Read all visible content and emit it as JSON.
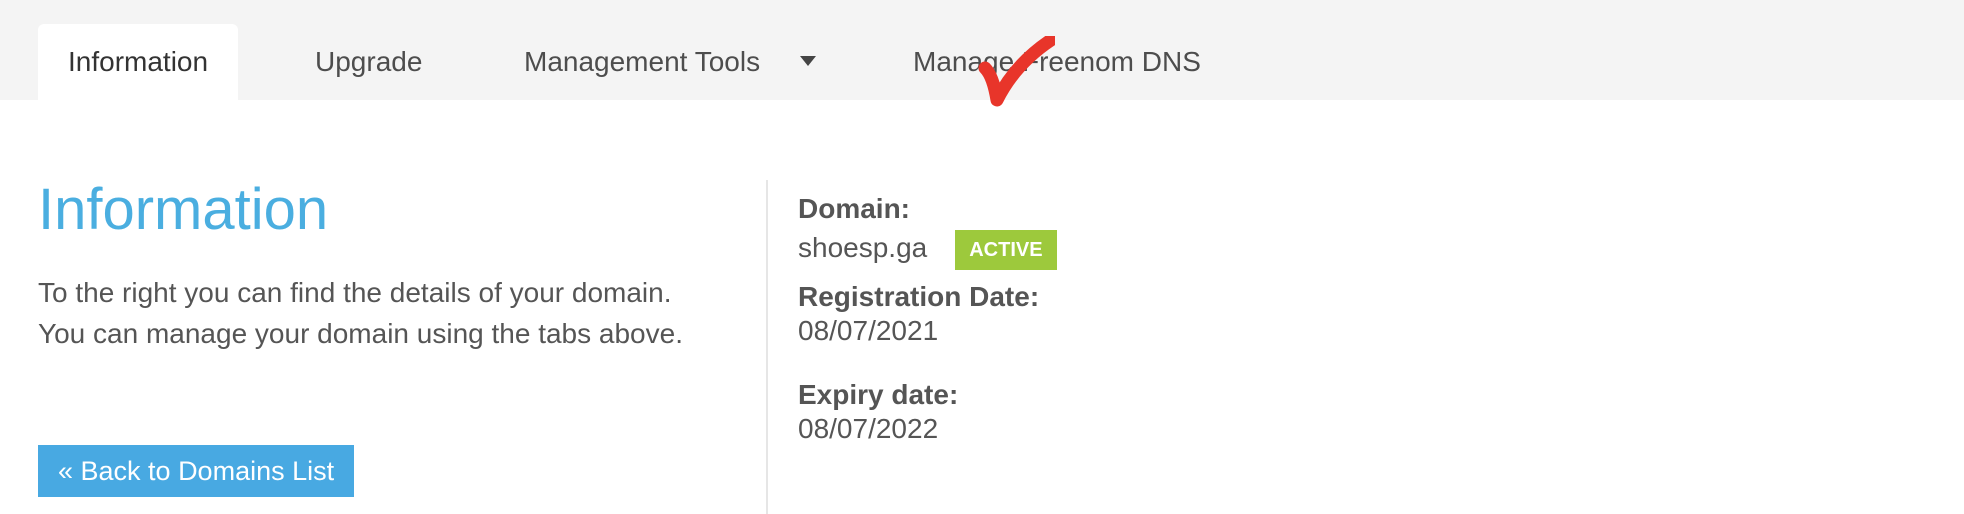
{
  "tabs": [
    {
      "label": "Information",
      "active": true
    },
    {
      "label": "Upgrade",
      "active": false
    },
    {
      "label": "Management Tools",
      "active": false,
      "has_dropdown": true
    },
    {
      "label": "Manage Freenom DNS",
      "active": false
    }
  ],
  "overlay": {
    "check_color": "#e8352a",
    "icon": "checkmark-icon"
  },
  "main": {
    "title": "Information",
    "intro_line1": "To the right you can find the details of your domain.",
    "intro_line2": "You can manage your domain using the tabs above.",
    "back_label": "« Back to Domains List"
  },
  "details": {
    "domain_label": "Domain:",
    "domain_value": "shoesp.ga",
    "status": "ACTIVE",
    "registration_label": "Registration Date:",
    "registration_value": "08/07/2021",
    "expiry_label": "Expiry date:",
    "expiry_value": "08/07/2022"
  },
  "colors": {
    "accent": "#4aaee0",
    "button": "#48a9e2",
    "status_active": "#9dc93c",
    "tab_bar": "#f4f4f4"
  }
}
